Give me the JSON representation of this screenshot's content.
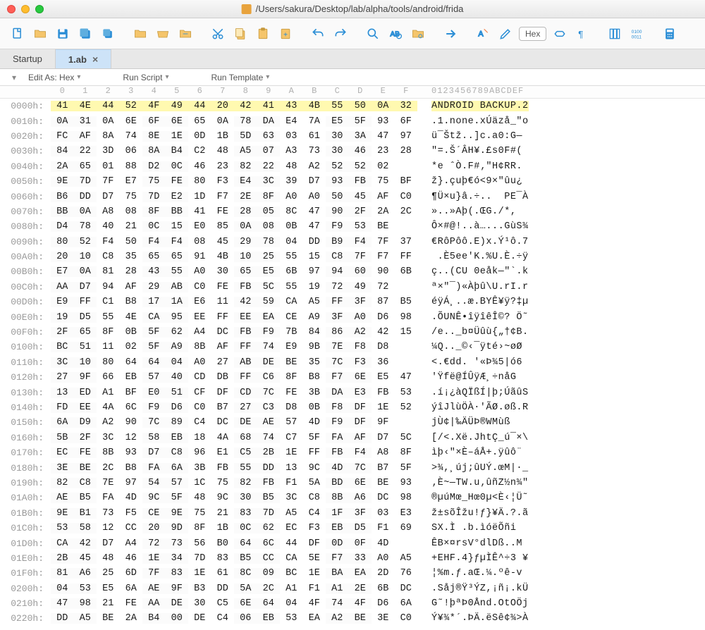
{
  "window": {
    "title": "/Users/sakura/Desktop/lab/alpha/tools/android/frida"
  },
  "tabs": {
    "startup": "Startup",
    "file": "1.ab"
  },
  "subheader": {
    "editAs": "Edit As: Hex",
    "runScript": "Run Script",
    "runTemplate": "Run Template"
  },
  "toolbar": {
    "hexLabel": "Hex"
  },
  "ruler": {
    "hex": [
      "0",
      "1",
      "2",
      "3",
      "4",
      "5",
      "6",
      "7",
      "8",
      "9",
      "A",
      "B",
      "C",
      "D",
      "E",
      "F"
    ],
    "ascii": "0123456789ABCDEF"
  },
  "rows": [
    {
      "addr": "0000h:",
      "hl": true,
      "hex": [
        "41",
        "4E",
        "44",
        "52",
        "4F",
        "49",
        "44",
        "20",
        "42",
        "41",
        "43",
        "4B",
        "55",
        "50",
        "0A",
        "32"
      ],
      "asc": "ANDROID BACKUP.2"
    },
    {
      "addr": "0010h:",
      "hex": [
        "0A",
        "31",
        "0A",
        "6E",
        "6F",
        "6E",
        "65",
        "0A",
        "78",
        "DA",
        "E4",
        "7A",
        "E5",
        "5F",
        "93",
        "6F"
      ],
      "asc": ".1.none.xÚäzå_\"o"
    },
    {
      "addr": "0020h:",
      "hex": [
        "FC",
        "AF",
        "8A",
        "74",
        "8E",
        "1E",
        "0D",
        "1B",
        "5D",
        "63",
        "03",
        "61",
        "30",
        "3A",
        "47",
        "97"
      ],
      "asc": "ü¯Štž..]c.a0:G—"
    },
    {
      "addr": "0030h:",
      "hex": [
        "84",
        "22",
        "3D",
        "06",
        "8A",
        "B4",
        "C2",
        "48",
        "A5",
        "07",
        "A3",
        "73",
        "30",
        "46",
        "23",
        "28"
      ],
      "asc": "\"=.Š´ÂH¥.£s0F#("
    },
    {
      "addr": "0040h:",
      "hex": [
        "2A",
        "65",
        "01",
        "88",
        "D2",
        "0C",
        "46",
        "23",
        "82",
        "22",
        "48",
        "A2",
        "52",
        "52",
        "02"
      ],
      "asc": "*e ˆÒ.F#‚\"H¢RR."
    },
    {
      "addr": "0050h:",
      "hex": [
        "9E",
        "7D",
        "7F",
        "E7",
        "75",
        "FE",
        "80",
        "F3",
        "E4",
        "3C",
        "39",
        "D7",
        "93",
        "FB",
        "75",
        "BF"
      ],
      "asc": "ž}.çuþ€ó<9×\"ûu¿"
    },
    {
      "addr": "0060h:",
      "hex": [
        "B6",
        "DD",
        "D7",
        "75",
        "7D",
        "E2",
        "1D",
        "F7",
        "2E",
        "8F",
        "A0",
        "A0",
        "50",
        "45",
        "AF",
        "C0"
      ],
      "asc": "¶Ü×u}â.÷..  PE¯À"
    },
    {
      "addr": "0070h:",
      "hex": [
        "BB",
        "0A",
        "A8",
        "08",
        "8F",
        "BB",
        "41",
        "FE",
        "28",
        "05",
        "8C",
        "47",
        "90",
        "2F",
        "2A",
        "2C"
      ],
      "asc": "»..»Aþ(.ŒG./*,"
    },
    {
      "addr": "0080h:",
      "hex": [
        "D4",
        "78",
        "40",
        "21",
        "0C",
        "15",
        "E0",
        "85",
        "0A",
        "08",
        "0B",
        "47",
        "F9",
        "53",
        "BE"
      ],
      "asc": "Ô×#@!..à…...GùS¾"
    },
    {
      "addr": "0090h:",
      "hex": [
        "80",
        "52",
        "F4",
        "50",
        "F4",
        "F4",
        "08",
        "45",
        "29",
        "78",
        "04",
        "DD",
        "B9",
        "F4",
        "7F",
        "37"
      ],
      "asc": "€RôPôô.E)x.Ý¹ô.7"
    },
    {
      "addr": "00A0h:",
      "hex": [
        "20",
        "10",
        "C8",
        "35",
        "65",
        "65",
        "91",
        "4B",
        "10",
        "25",
        "55",
        "15",
        "C8",
        "7F",
        "F7",
        "FF"
      ],
      "asc": " .È5ee'K.%U.È.÷ÿ"
    },
    {
      "addr": "00B0h:",
      "hex": [
        "E7",
        "0A",
        "81",
        "28",
        "43",
        "55",
        "A0",
        "30",
        "65",
        "E5",
        "6B",
        "97",
        "94",
        "60",
        "90",
        "6B"
      ],
      "asc": "ç..(CU 0eåk—\"`.k"
    },
    {
      "addr": "00C0h:",
      "hex": [
        "AA",
        "D7",
        "94",
        "AF",
        "29",
        "AB",
        "C0",
        "FE",
        "FB",
        "5C",
        "55",
        "19",
        "72",
        "49",
        "72"
      ],
      "asc": "ª×\"¯)«Àþû\\U.rI.r"
    },
    {
      "addr": "00D0h:",
      "hex": [
        "E9",
        "FF",
        "C1",
        "B8",
        "17",
        "1A",
        "E6",
        "11",
        "42",
        "59",
        "CA",
        "A5",
        "FF",
        "3F",
        "87",
        "B5"
      ],
      "asc": "éÿÁ¸..æ.BYÊ¥ÿ?‡µ"
    },
    {
      "addr": "00E0h:",
      "hex": [
        "19",
        "D5",
        "55",
        "4E",
        "CA",
        "95",
        "EE",
        "FF",
        "EE",
        "EA",
        "CE",
        "A9",
        "3F",
        "A0",
        "D6",
        "98"
      ],
      "asc": ".ÕUNÊ•îÿîêÎ©? Ö˜"
    },
    {
      "addr": "00F0h:",
      "hex": [
        "2F",
        "65",
        "8F",
        "0B",
        "5F",
        "62",
        "A4",
        "DC",
        "FB",
        "F9",
        "7B",
        "84",
        "86",
        "A2",
        "42",
        "15"
      ],
      "asc": "/e.._b¤Üûù{„†¢B."
    },
    {
      "addr": "0100h:",
      "hex": [
        "BC",
        "51",
        "11",
        "02",
        "5F",
        "A9",
        "8B",
        "AF",
        "FF",
        "74",
        "E9",
        "9B",
        "7E",
        "F8",
        "D8"
      ],
      "asc": "¼Q.._©‹¯ÿté›~øØ"
    },
    {
      "addr": "0110h:",
      "hex": [
        "3C",
        "10",
        "80",
        "64",
        "64",
        "04",
        "A0",
        "27",
        "AB",
        "DE",
        "BE",
        "35",
        "7C",
        "F3",
        "36"
      ],
      "asc": "<.€dd. '«Þ¾5|ó6"
    },
    {
      "addr": "0120h:",
      "hex": [
        "27",
        "9F",
        "66",
        "EB",
        "57",
        "40",
        "CD",
        "DB",
        "FF",
        "C6",
        "8F",
        "B8",
        "F7",
        "6E",
        "E5",
        "47"
      ],
      "asc": "'Ÿfë@ÍÛÿÆ¸÷nåG"
    },
    {
      "addr": "0130h:",
      "hex": [
        "13",
        "ED",
        "A1",
        "BF",
        "E0",
        "51",
        "CF",
        "DF",
        "CD",
        "7C",
        "FE",
        "3B",
        "DA",
        "E3",
        "FB",
        "53"
      ],
      "asc": ".í¡¿àQÏßÍ|þ;ÚãûS"
    },
    {
      "addr": "0140h:",
      "hex": [
        "FD",
        "EE",
        "4A",
        "6C",
        "F9",
        "D6",
        "C0",
        "B7",
        "27",
        "C3",
        "D8",
        "0B",
        "F8",
        "DF",
        "1E",
        "52"
      ],
      "asc": "ýîJlùÖÀ·'ÃØ.øß.R"
    },
    {
      "addr": "0150h:",
      "hex": [
        "6A",
        "D9",
        "A2",
        "90",
        "7C",
        "89",
        "C4",
        "DC",
        "DE",
        "AE",
        "57",
        "4D",
        "F9",
        "DF",
        "9F"
      ],
      "asc": "jÙ¢|‰ÄÜÞ®WMùß"
    },
    {
      "addr": "0160h:",
      "hex": [
        "5B",
        "2F",
        "3C",
        "12",
        "58",
        "EB",
        "18",
        "4A",
        "68",
        "74",
        "C7",
        "5F",
        "FA",
        "AF",
        "D7",
        "5C"
      ],
      "asc": "[/<.Xë.JhtÇ_ú¯×\\"
    },
    {
      "addr": "0170h:",
      "hex": [
        "EC",
        "FE",
        "8B",
        "93",
        "D7",
        "C8",
        "96",
        "E1",
        "C5",
        "2B",
        "1E",
        "FF",
        "FB",
        "F4",
        "A8",
        "8F"
      ],
      "asc": "ìþ‹\"×È–áÅ+.ÿûô¨"
    },
    {
      "addr": "0180h:",
      "hex": [
        "3E",
        "BE",
        "2C",
        "B8",
        "FA",
        "6A",
        "3B",
        "FB",
        "55",
        "DD",
        "13",
        "9C",
        "4D",
        "7C",
        "B7",
        "5F"
      ],
      "asc": ">¾,¸új;ûUÝ.œM|·_"
    },
    {
      "addr": "0190h:",
      "hex": [
        "82",
        "C8",
        "7E",
        "97",
        "54",
        "57",
        "1C",
        "75",
        "82",
        "FB",
        "F1",
        "5A",
        "BD",
        "6E",
        "BE",
        "93"
      ],
      "asc": "‚È~—TW.u‚ûñZ½n¾\""
    },
    {
      "addr": "01A0h:",
      "hex": [
        "AE",
        "B5",
        "FA",
        "4D",
        "9C",
        "5F",
        "48",
        "9C",
        "30",
        "B5",
        "3C",
        "C8",
        "8B",
        "A6",
        "DC",
        "98"
      ],
      "asc": "®µúMœ_Hœ0µ<È‹¦Ü˜"
    },
    {
      "addr": "01B0h:",
      "hex": [
        "9E",
        "B1",
        "73",
        "F5",
        "CE",
        "9E",
        "75",
        "21",
        "83",
        "7D",
        "A5",
        "C4",
        "1F",
        "3F",
        "03",
        "E3"
      ],
      "asc": "ž±sõÎžu!ƒ}¥Ä.?.ã"
    },
    {
      "addr": "01C0h:",
      "hex": [
        "53",
        "58",
        "12",
        "CC",
        "20",
        "9D",
        "8F",
        "1B",
        "0C",
        "62",
        "EC",
        "F3",
        "EB",
        "D5",
        "F1",
        "69"
      ],
      "asc": "SX.Ì .b.ìóëÕñi"
    },
    {
      "addr": "01D0h:",
      "hex": [
        "CA",
        "42",
        "D7",
        "A4",
        "72",
        "73",
        "56",
        "B0",
        "64",
        "6C",
        "44",
        "DF",
        "0D",
        "0F",
        "4D"
      ],
      "asc": "ÊB×¤rsV°dlDß..M"
    },
    {
      "addr": "01E0h:",
      "hex": [
        "2B",
        "45",
        "48",
        "46",
        "1E",
        "34",
        "7D",
        "83",
        "B5",
        "CC",
        "CA",
        "5E",
        "F7",
        "33",
        "A0",
        "A5"
      ],
      "asc": "+EHF.4}ƒµÌÊ^÷3 ¥"
    },
    {
      "addr": "01F0h:",
      "hex": [
        "81",
        "A6",
        "25",
        "6D",
        "7F",
        "83",
        "1E",
        "61",
        "8C",
        "09",
        "BC",
        "1E",
        "BA",
        "EA",
        "2D",
        "76"
      ],
      "asc": "¦%m.ƒ.aŒ.¼.ºê-v"
    },
    {
      "addr": "0200h:",
      "hex": [
        "04",
        "53",
        "E5",
        "6A",
        "AE",
        "9F",
        "B3",
        "DD",
        "5A",
        "2C",
        "A1",
        "F1",
        "A1",
        "2E",
        "6B",
        "DC"
      ],
      "asc": ".Såj®Ÿ³ÝZ,¡ñ¡.kÜ"
    },
    {
      "addr": "0210h:",
      "hex": [
        "47",
        "98",
        "21",
        "FE",
        "AA",
        "DE",
        "30",
        "C5",
        "6E",
        "64",
        "04",
        "4F",
        "74",
        "4F",
        "D6",
        "6A"
      ],
      "asc": "G˜!þªÞ0Ånd.OtOÖj"
    },
    {
      "addr": "0220h:",
      "hex": [
        "DD",
        "A5",
        "BE",
        "2A",
        "B4",
        "00",
        "DE",
        "C4",
        "06",
        "EB",
        "53",
        "EA",
        "A2",
        "BE",
        "3E",
        "C0"
      ],
      "asc": "Ý¥¾*´.ÞÄ.ëSê¢¾>À"
    }
  ]
}
